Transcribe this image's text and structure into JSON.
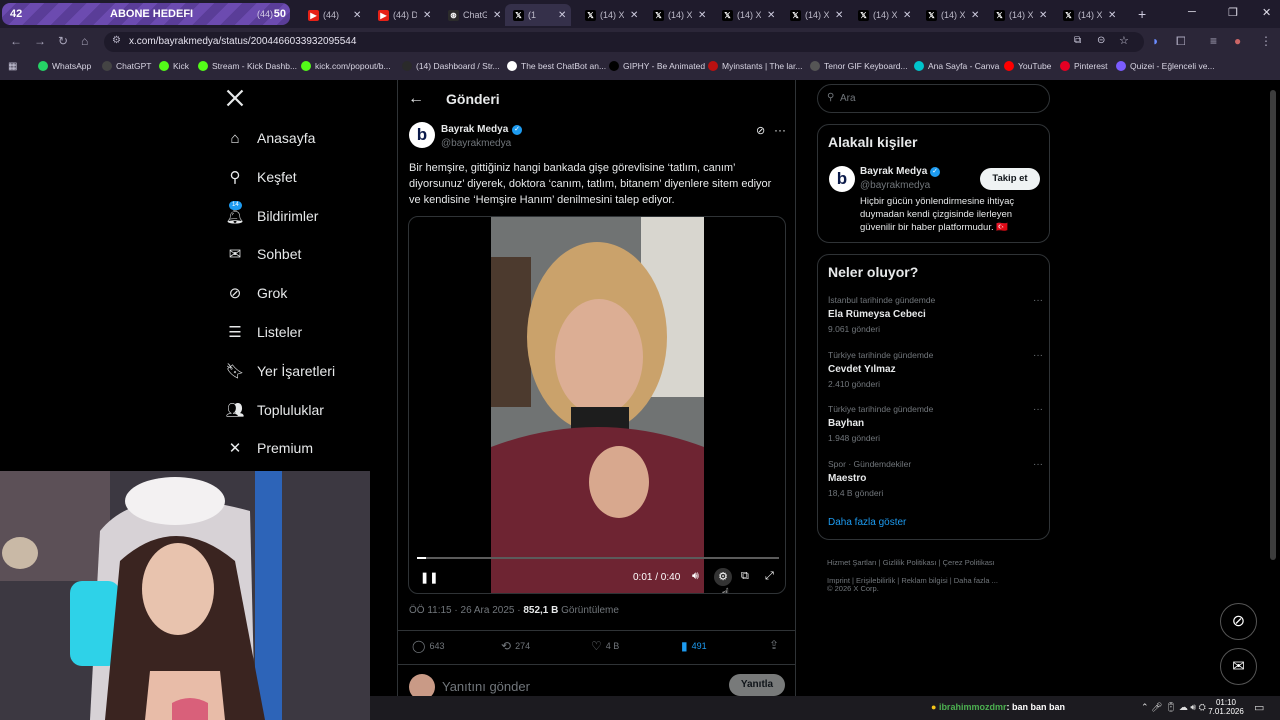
{
  "browser": {
    "tabs": [
      {
        "label": "(44) ",
        "icon": "youtube-icon"
      },
      {
        "label": "(44) D",
        "icon": "youtube-icon"
      },
      {
        "label": "ChatG",
        "icon": "chatgpt-icon"
      },
      {
        "label": "(1",
        "icon": "x-icon",
        "active": true
      },
      {
        "label": "(14) X",
        "icon": "x-icon"
      },
      {
        "label": "(14) X",
        "icon": "x-icon"
      },
      {
        "label": "(14) X",
        "icon": "x-icon"
      },
      {
        "label": "(14) X",
        "icon": "x-icon"
      },
      {
        "label": "(14) X",
        "icon": "x-icon"
      },
      {
        "label": "(14) X",
        "icon": "x-icon"
      },
      {
        "label": "(14) X",
        "icon": "x-icon"
      },
      {
        "label": "(14) X",
        "icon": "x-icon"
      }
    ],
    "url": "x.com/bayrakmedya/status/2004466033932095544",
    "bookmarks": [
      "WhatsApp",
      "ChatGPT",
      "Kick",
      "Stream - Kick Dashb...",
      "kick.com/popout/b...",
      "(14) Dashboard / Str...",
      "The best ChatBot an...",
      "GIPHY - Be Animated",
      "Myinstants | The lar...",
      "Tenor GIF Keyboard...",
      "Ana Sayfa - Canva",
      "YouTube",
      "Pinterest",
      "Quizei - Eğlenceli ve..."
    ]
  },
  "overlay": {
    "count": "42",
    "goal_label": "ABONE HEDEFI",
    "mid": "(44)",
    "goal": "50"
  },
  "nav": {
    "items": [
      {
        "label": "Anasayfa",
        "icon": "home-icon"
      },
      {
        "label": "Keşfet",
        "icon": "search-icon"
      },
      {
        "label": "Bildirimler",
        "icon": "bell-icon",
        "badge": "14"
      },
      {
        "label": "Sohbet",
        "icon": "mail-icon"
      },
      {
        "label": "Grok",
        "icon": "grok-icon"
      },
      {
        "label": "Listeler",
        "icon": "list-icon"
      },
      {
        "label": "Yer İşaretleri",
        "icon": "bookmark-icon"
      },
      {
        "label": "Topluluklar",
        "icon": "people-icon"
      },
      {
        "label": "Premium",
        "icon": "x-logo-icon"
      }
    ]
  },
  "post": {
    "header": "Gönderi",
    "author_name": "Bayrak Medya",
    "author_handle": "@bayrakmedya",
    "text": "Bir hemşire, gittiğiniz hangi bankada gişe görevlisine ‘tatlım, canım’ diyorsunuz’ diyerek, doktora ‘canım, tatlım, bitanem’ diyenlere sitem ediyor ve kendisine ‘Hemşire Hanım’ denilmesini talep ediyor.",
    "video_time": "0:01 / 0:40",
    "video_progress": 0.025,
    "timestamp": "ÖÖ 11:15 · 26 Ara 2025 · ",
    "views": "852,1 B",
    "views_label": "Görüntüleme",
    "replies": "643",
    "reposts": "274",
    "likes": "4 B",
    "bookmarks": "491",
    "reply_placeholder": "Yanıtını gönder",
    "reply_button": "Yanıtla"
  },
  "search": {
    "placeholder": "Ara"
  },
  "related": {
    "title": "Alakalı kişiler",
    "name": "Bayrak Medya",
    "handle": "@bayrakmedya",
    "follow_label": "Takip et",
    "bio": "Hiçbir gücün yönlendirmesine ihtiyaç duymadan kendi çizgisinde ilerleyen güvenilir bir haber platformudur. 🇹🇷"
  },
  "trends": {
    "title": "Neler oluyor?",
    "items": [
      {
        "category": "İstanbul tarihinde gündemde",
        "title": "Ela Rümeysa Cebeci",
        "count": "9.061 gönderi"
      },
      {
        "category": "Türkiye tarihinde gündemde",
        "title": "Cevdet Yılmaz",
        "count": "2.410 gönderi"
      },
      {
        "category": "Türkiye tarihinde gündemde",
        "title": "Bayhan",
        "count": "1.948 gönderi"
      },
      {
        "category": "Spor · Gündemdekiler",
        "title": "Maestro",
        "count": "18,4 B gönderi"
      }
    ],
    "show_more": "Daha fazla göster"
  },
  "footer": {
    "links": [
      "Hizmet Şartları",
      "Gizlilik Politikası",
      "Çerez Politikası",
      "Imprint",
      "Erişilebilirlik",
      "Reklam bilgisi",
      "Daha fazla ..."
    ],
    "copyright": "© 2026 X Corp."
  },
  "taskbar": {
    "chat_user": "ibrahimmozdmr",
    "chat_message": ": ban ban ban",
    "time": "01:10",
    "date": "7.01.2026"
  },
  "colors": {
    "accent": "#1d9bf0",
    "tabbar": "#1f1b2c",
    "overlay": "#6c4bb0"
  }
}
